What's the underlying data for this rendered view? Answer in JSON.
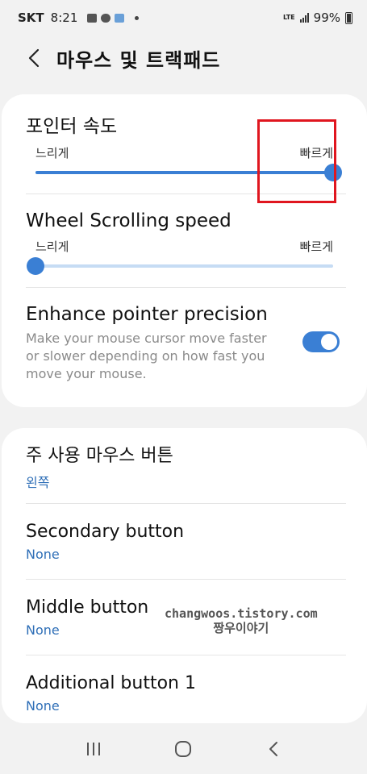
{
  "status": {
    "carrier": "SKT",
    "time": "8:21",
    "network": "LTE",
    "battery": "99%"
  },
  "header": {
    "title": "마우스 및 트랙패드"
  },
  "pointer_speed": {
    "title": "포인터 속도",
    "min_label": "느리게",
    "max_label": "빠르게",
    "value": 1.0
  },
  "wheel_speed": {
    "title": "Wheel Scrolling speed",
    "min_label": "느리게",
    "max_label": "빠르게",
    "value": 0.0
  },
  "precision": {
    "title": "Enhance pointer precision",
    "description": "Make your mouse cursor move faster or slower depending on how fast you move your mouse.",
    "enabled": true
  },
  "buttons": [
    {
      "title": "주 사용 마우스 버튼",
      "value": "왼쪽"
    },
    {
      "title": "Secondary button",
      "value": "None"
    },
    {
      "title": "Middle button",
      "value": "None"
    },
    {
      "title": "Additional button 1",
      "value": "None"
    }
  ],
  "watermark": {
    "line1": "changwoos.tistory.com",
    "line2": "짱우이야기"
  },
  "colors": {
    "accent": "#3a7fd4",
    "highlight": "#e0161f"
  }
}
